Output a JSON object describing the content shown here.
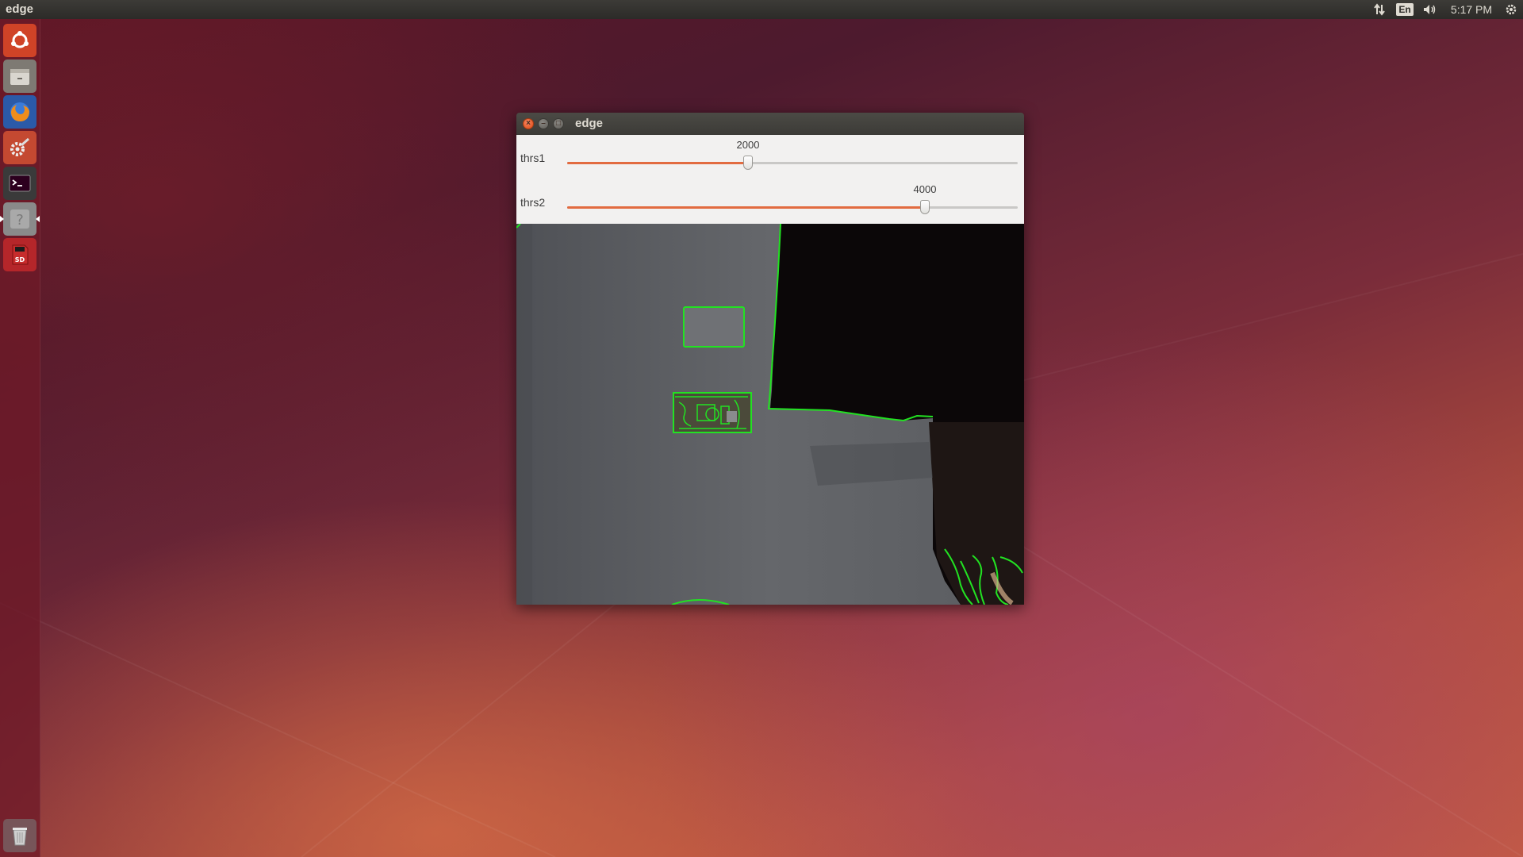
{
  "top_panel": {
    "app_title": "edge",
    "tray": {
      "network_icon": "up-down-arrows-icon",
      "keyboard_layout": "En",
      "volume_icon": "speaker-icon",
      "clock": "5:17 PM",
      "session_icon": "gear-icon"
    }
  },
  "launcher": {
    "items": [
      {
        "name": "dash-home",
        "icon": "ubuntu-logo-icon"
      },
      {
        "name": "files",
        "icon": "file-cabinet-icon"
      },
      {
        "name": "firefox",
        "icon": "firefox-icon"
      },
      {
        "name": "system-settings",
        "icon": "settings-gears-icon"
      },
      {
        "name": "terminal",
        "icon": "terminal-icon"
      },
      {
        "name": "unknown-app",
        "icon": "question-mark-icon"
      },
      {
        "name": "sd-card",
        "icon": "sd-card-icon",
        "label": "SD"
      },
      {
        "name": "trash",
        "icon": "trash-icon"
      }
    ]
  },
  "window": {
    "title": "edge",
    "trackbars": [
      {
        "label": "thrs1",
        "value": "2000",
        "fraction": 0.4
      },
      {
        "label": "thrs2",
        "value": "4000",
        "fraction": 0.8
      }
    ]
  },
  "colors": {
    "edge_color": "#22e222",
    "slider_accent": "#e26b40",
    "close_button": "#df4a16"
  }
}
